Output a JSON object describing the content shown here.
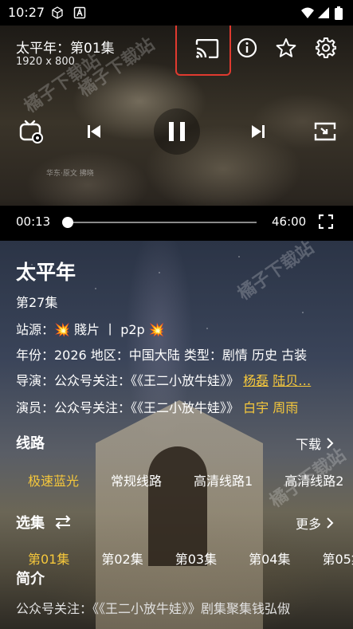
{
  "status_bar": {
    "time": "10:27"
  },
  "video": {
    "title": "太平年：第01集",
    "resolution": "1920 x 800",
    "watermark": "橘子下载站",
    "seal_text": "华东·原文 拂晓",
    "current_time": "00:13",
    "duration": "46:00",
    "progress_fraction": 0.005
  },
  "details": {
    "title": "太平年",
    "episode": "第27集",
    "source_label": "站源：",
    "source_value": "💥 賤片 丨 p2p 💥",
    "meta": "年份：2026  地区：中国大陆  类型：剧情 历史 古装",
    "director_prefix": "导演：公众号关注：《《王二小放牛娃》》",
    "director_links": [
      "杨磊",
      "陆贝…"
    ],
    "cast_prefix": "演员：公众号关注：《《王二小放牛娃》》",
    "cast_links": [
      "白宇",
      "周雨"
    ],
    "watermark": "橘子下载站"
  },
  "routes": {
    "title": "线路",
    "more": "下载",
    "items": [
      "极速蓝光",
      "常规线路",
      "高清线路1",
      "高清线路2"
    ],
    "active_index": 0
  },
  "episodes": {
    "title": "选集",
    "more": "更多",
    "items": [
      "第01集",
      "第02集",
      "第03集",
      "第04集",
      "第05集"
    ],
    "active_index": 0
  },
  "intro": {
    "title": "简介",
    "text": "公众号关注：《《王二小放牛娃》》剧集聚集钱弘俶"
  },
  "colors": {
    "accent": "#f6c83b",
    "highlight": "#e03a2f"
  }
}
